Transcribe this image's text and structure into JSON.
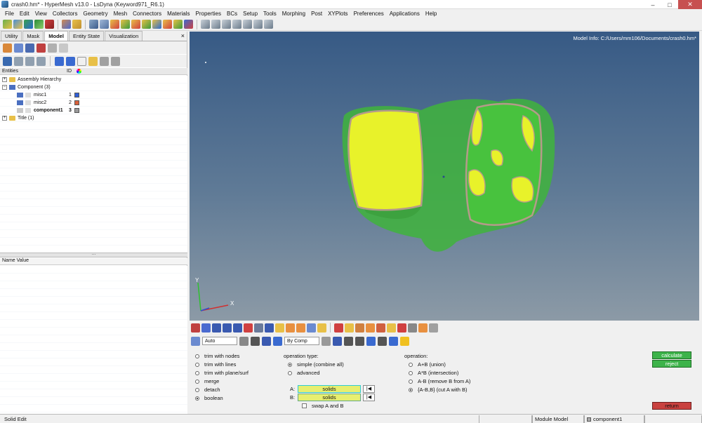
{
  "window": {
    "title": "crash0.hm* - HyperMesh v13.0 - LsDyna (Keyword971_R6.1)",
    "minimize": "–",
    "maximize": "□",
    "close": "✕"
  },
  "menu": [
    "File",
    "Edit",
    "View",
    "Collectors",
    "Geometry",
    "Mesh",
    "Connectors",
    "Materials",
    "Properties",
    "BCs",
    "Setup",
    "Tools",
    "Morphing",
    "Post",
    "XYPlots",
    "Preferences",
    "Applications",
    "Help"
  ],
  "browser": {
    "tabs": [
      "Utility",
      "Mask",
      "Model",
      "Entity State",
      "Visualization"
    ],
    "active_tab": "Model",
    "close": "×",
    "columns": {
      "entities": "Entities",
      "id": "ID"
    },
    "tree": {
      "assembly": "Assembly Hierarchy",
      "component": "Component (3)",
      "items": [
        {
          "name": "misc1",
          "id": "1",
          "color": "#2f5fd8"
        },
        {
          "name": "misc2",
          "id": "2",
          "color": "#d9603a"
        },
        {
          "name": "component1",
          "id": "3",
          "color": "#9a9a9a"
        }
      ],
      "title_node": "Title (1)"
    },
    "name_value_header": "Name Value"
  },
  "viewport": {
    "model_info": "Model Info: C:/Users/mm106/Documents/crash0.hm*",
    "axis_x": "X",
    "axis_y": "Y",
    "colors": {
      "shell": "#3fb43c",
      "yellow": "#e8f22a",
      "edge": "#b59a8a"
    }
  },
  "bottom_toolbar": {
    "auto_select": "Auto",
    "by_comp": "By Comp"
  },
  "panel": {
    "trim_options": [
      {
        "label": "trim with nodes",
        "checked": false
      },
      {
        "label": "trim with lines",
        "checked": false
      },
      {
        "label": "trim with plane/surf",
        "checked": false
      },
      {
        "label": "merge",
        "checked": false
      },
      {
        "label": "detach",
        "checked": false
      },
      {
        "label": "boolean",
        "checked": true
      }
    ],
    "operation_type_label": "operation type:",
    "operation_type": [
      {
        "label": "simple (combine all)",
        "checked": true
      },
      {
        "label": "advanced",
        "checked": false
      }
    ],
    "a_label": "A:",
    "a_value": "solids",
    "b_label": "B:",
    "b_value": "solids",
    "reset_glyph": "|◀",
    "swap_label": "swap A and B",
    "operation_label": "operation:",
    "operations": [
      {
        "label": "A+B (union)",
        "checked": false
      },
      {
        "label": "A*B (intersection)",
        "checked": false
      },
      {
        "label": "A-B (remove B from A)",
        "checked": false
      },
      {
        "label": "{A-B,B} (cut A with B)",
        "checked": true
      }
    ],
    "calculate": "calculate",
    "reject": "reject",
    "return": "return"
  },
  "status": {
    "left": "Solid Edit",
    "module": "Module Model",
    "component": "component1"
  }
}
